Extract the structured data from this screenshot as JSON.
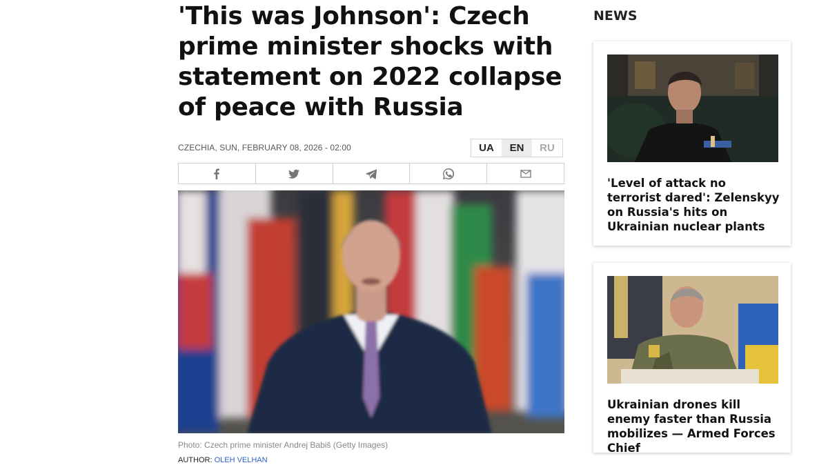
{
  "article": {
    "headline": "'This was Johnson': Czech prime minister shocks with statement on 2022 collapse of peace with Russia",
    "meta": "CZECHIA, SUN, FEBRUARY 08, 2026 - 02:00",
    "languages": [
      {
        "code": "UA",
        "state": "available"
      },
      {
        "code": "EN",
        "state": "active"
      },
      {
        "code": "RU",
        "state": "disabled"
      }
    ],
    "share": [
      "facebook-icon",
      "twitter-icon",
      "telegram-icon",
      "whatsapp-icon",
      "email-icon"
    ],
    "photo_caption": "Photo: Czech prime minister Andrej Babiš (Getty Images)",
    "author_label": "AUTHOR:",
    "author_name": "OLEH VELHAN"
  },
  "sidebar": {
    "title": "NEWS",
    "cards": [
      {
        "title": "'Level of attack no terrorist dared': Zelenskyy on Russia's hits on Ukrainian nuclear plants"
      },
      {
        "title": "Ukrainian drones kill enemy faster than Russia mobilizes — Armed Forces Chief"
      }
    ]
  },
  "colors": {
    "link": "#2a64c5",
    "accent_active_lang": "#ececec"
  }
}
